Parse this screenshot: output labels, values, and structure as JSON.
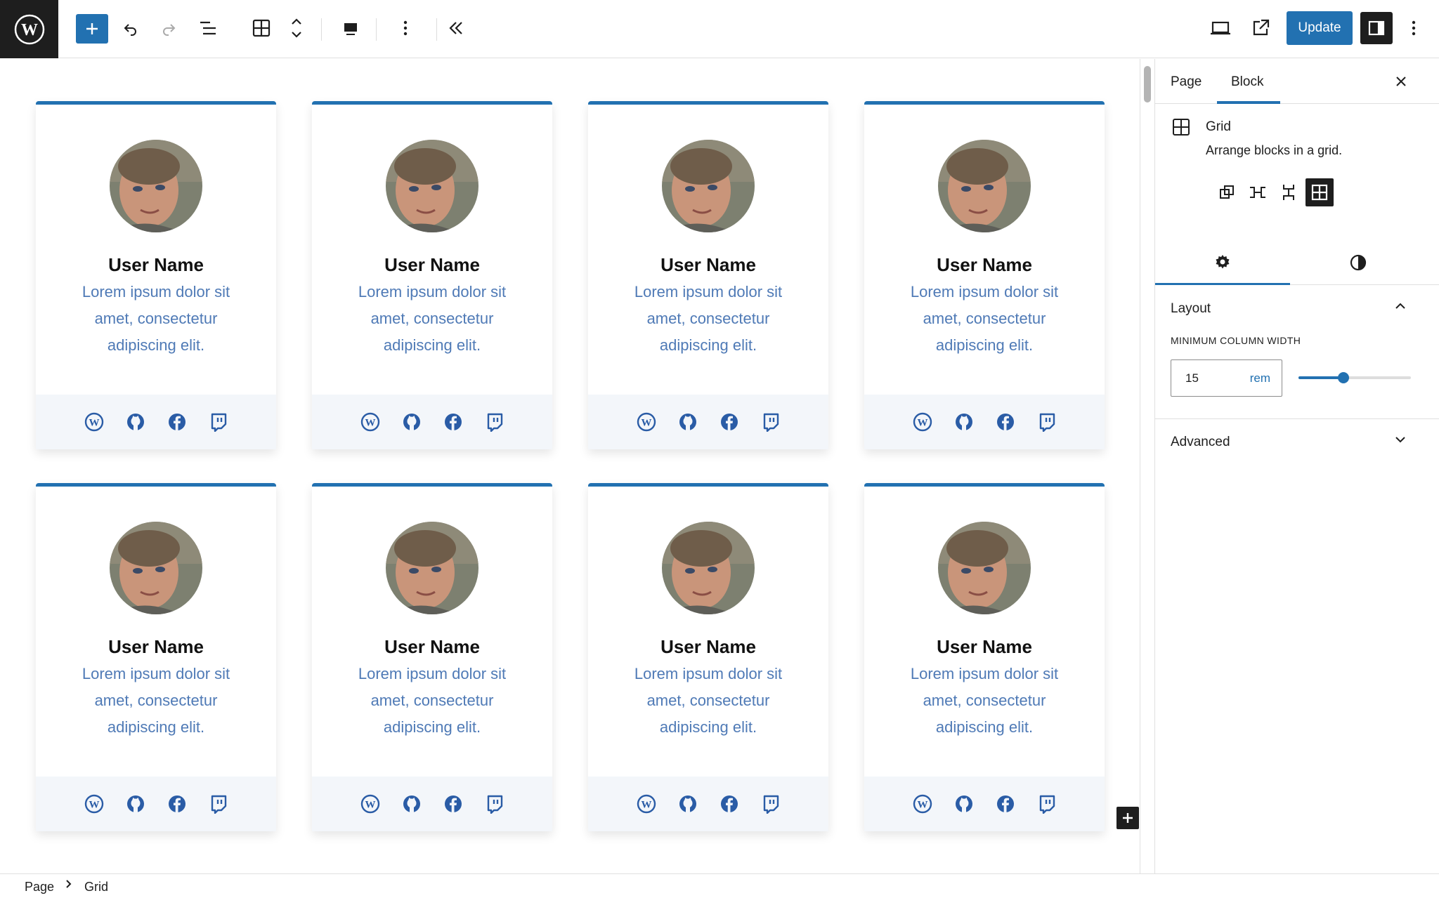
{
  "toolbar": {
    "update_label": "Update"
  },
  "cards": [
    {
      "name": "User Name",
      "bio": "Lorem ipsum dolor sit amet, consectetur adipiscing elit."
    },
    {
      "name": "User Name",
      "bio": "Lorem ipsum dolor sit amet, consectetur adipiscing elit."
    },
    {
      "name": "User Name",
      "bio": "Lorem ipsum dolor sit amet, consectetur adipiscing elit."
    },
    {
      "name": "User Name",
      "bio": "Lorem ipsum dolor sit amet, consectetur adipiscing elit."
    },
    {
      "name": "User Name",
      "bio": "Lorem ipsum dolor sit amet, consectetur adipiscing elit."
    },
    {
      "name": "User Name",
      "bio": "Lorem ipsum dolor sit amet, consectetur adipiscing elit."
    },
    {
      "name": "User Name",
      "bio": "Lorem ipsum dolor sit amet, consectetur adipiscing elit."
    },
    {
      "name": "User Name",
      "bio": "Lorem ipsum dolor sit amet, consectetur adipiscing elit."
    }
  ],
  "social_icons": [
    "wordpress-icon",
    "github-icon",
    "facebook-icon",
    "twitch-icon"
  ],
  "breadcrumb": {
    "root": "Page",
    "current": "Grid"
  },
  "sidebar": {
    "tabs": {
      "page": "Page",
      "block": "Block"
    },
    "block_card": {
      "title": "Grid",
      "description": "Arrange blocks in a grid."
    },
    "layout": {
      "title": "Layout",
      "min_width_label": "Minimum column width",
      "min_width_value": "15",
      "min_width_unit": "rem",
      "slider_fraction": 0.4
    },
    "advanced": {
      "title": "Advanced"
    }
  },
  "colors": {
    "accent": "#2271b1",
    "bio_text": "#4f7ab6",
    "card_footer": "#f3f6fa"
  }
}
